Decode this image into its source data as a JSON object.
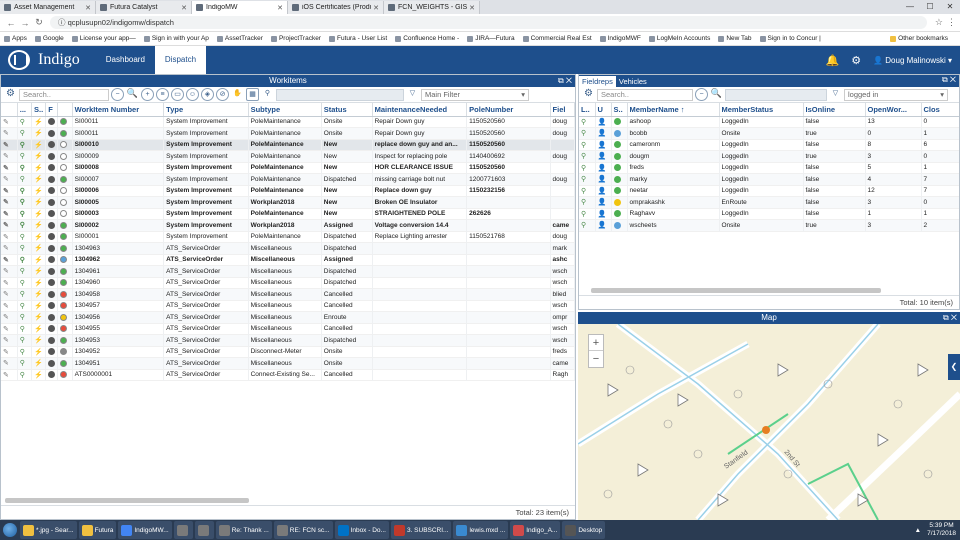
{
  "browser": {
    "tabs": [
      {
        "label": "Asset Management",
        "active": false
      },
      {
        "label": "Futura Catalyst",
        "active": false
      },
      {
        "label": "IndigoMW",
        "active": true
      },
      {
        "label": "iOS Certificates (Producti",
        "active": false
      },
      {
        "label": "FCN_WEIGHTS - GIS v2.0",
        "active": false
      }
    ],
    "url": "qcplusupn02/indigomw/dispatch",
    "bookmarks": [
      "Apps",
      "Google",
      "License your app—",
      "Sign in with your Ap",
      "AssetTracker",
      "ProjectTracker",
      "Futura - User List",
      "Confluence Home -",
      "JIRA—Futura",
      "Commercial Real Est",
      "IndigoMWF",
      "LogMeIn Accounts",
      "New Tab",
      "Sign in to Concur |"
    ],
    "other_bookmarks": "Other bookmarks"
  },
  "app": {
    "brand": "Indigo",
    "nav": [
      {
        "label": "Dashboard",
        "active": false
      },
      {
        "label": "Dispatch",
        "active": true
      }
    ],
    "user": "Doug Malinowski"
  },
  "workitems": {
    "title": "Workitems",
    "search_placeholder": "Search..",
    "filter_placeholder": "Main Filter",
    "columns": [
      "",
      "...",
      "S..",
      "F",
      "",
      "WorkItem Number",
      "Type",
      "Subtype",
      "Status",
      "MaintenanceNeeded",
      "PoleNumber",
      "Fiel"
    ],
    "rows": [
      {
        "num": "SI00011",
        "type": "System Improvement",
        "subtype": "PoleMaintenance",
        "status": "Onsite",
        "maint": "Repair Down guy",
        "pole": "1150520560",
        "field": "doug",
        "bold": false,
        "status_color": "#4caf50"
      },
      {
        "num": "SI00011",
        "type": "System Improvement",
        "subtype": "PoleMaintenance",
        "status": "Onsite",
        "maint": "Repair Down guy",
        "pole": "1150520560",
        "field": "doug",
        "bold": false,
        "status_color": "#4caf50"
      },
      {
        "num": "SI00010",
        "type": "System Improvement",
        "subtype": "PoleMaintenance",
        "status": "New",
        "maint": "replace down guy and an...",
        "pole": "1150520560",
        "field": "",
        "bold": true,
        "selected": true,
        "status_color": "#fff"
      },
      {
        "num": "SI00009",
        "type": "System Improvement",
        "subtype": "PoleMaintenance",
        "status": "New",
        "maint": "Inspect for replacing pole",
        "pole": "1140400692",
        "field": "doug",
        "bold": false,
        "status_color": "#fff"
      },
      {
        "num": "SI00008",
        "type": "System Improvement",
        "subtype": "PoleMaintenance",
        "status": "New",
        "maint": "HOR CLEARANCE ISSUE",
        "pole": "1150520560",
        "field": "",
        "bold": true,
        "status_color": "#fff"
      },
      {
        "num": "SI00007",
        "type": "System Improvement",
        "subtype": "PoleMaintenance",
        "status": "Dispatched",
        "maint": "missing carriage bolt nut",
        "pole": "1200771603",
        "field": "doug",
        "bold": false,
        "status_color": "#4caf50"
      },
      {
        "num": "SI00006",
        "type": "System Improvement",
        "subtype": "PoleMaintenance",
        "status": "New",
        "maint": "Replace down guy",
        "pole": "1150232156",
        "field": "",
        "bold": true,
        "status_color": "#fff"
      },
      {
        "num": "SI00005",
        "type": "System Improvement",
        "subtype": "Workplan2018",
        "status": "New",
        "maint": "Broken OE Insulator",
        "pole": "",
        "field": "",
        "bold": true,
        "status_color": "#fff"
      },
      {
        "num": "SI00003",
        "type": "System Improvement",
        "subtype": "PoleMaintenance",
        "status": "New",
        "maint": "STRAIGHTENED POLE",
        "pole": "262626",
        "field": "",
        "bold": true,
        "status_color": "#fff"
      },
      {
        "num": "SI00002",
        "type": "System Improvement",
        "subtype": "Workplan2018",
        "status": "Assigned",
        "maint": "Voltage conversion 14.4",
        "pole": "",
        "field": "came",
        "bold": true,
        "status_color": "#4caf50"
      },
      {
        "num": "SI00001",
        "type": "System Improvement",
        "subtype": "PoleMaintenance",
        "status": "Dispatched",
        "maint": "Replace Lighting arrester",
        "pole": "1150521768",
        "field": "doug",
        "bold": false,
        "status_color": "#4caf50"
      },
      {
        "num": "1304963",
        "type": "ATS_ServiceOrder",
        "subtype": "Miscellaneous",
        "status": "Dispatched",
        "maint": "",
        "pole": "",
        "field": "mark",
        "bold": false,
        "status_color": "#4caf50"
      },
      {
        "num": "1304962",
        "type": "ATS_ServiceOrder",
        "subtype": "Miscellaneous",
        "status": "Assigned",
        "maint": "",
        "pole": "",
        "field": "ashc",
        "bold": true,
        "status_color": "#5aa0d8"
      },
      {
        "num": "1304961",
        "type": "ATS_ServiceOrder",
        "subtype": "Miscellaneous",
        "status": "Dispatched",
        "maint": "",
        "pole": "",
        "field": "wsch",
        "bold": false,
        "status_color": "#4caf50"
      },
      {
        "num": "1304960",
        "type": "ATS_ServiceOrder",
        "subtype": "Miscellaneous",
        "status": "Dispatched",
        "maint": "",
        "pole": "",
        "field": "wsch",
        "bold": false,
        "status_color": "#4caf50"
      },
      {
        "num": "1304958",
        "type": "ATS_ServiceOrder",
        "subtype": "Miscellaneous",
        "status": "Cancelled",
        "maint": "",
        "pole": "",
        "field": "blied",
        "bold": false,
        "status_color": "#e74c3c"
      },
      {
        "num": "1304957",
        "type": "ATS_ServiceOrder",
        "subtype": "Miscellaneous",
        "status": "Cancelled",
        "maint": "",
        "pole": "",
        "field": "wsch",
        "bold": false,
        "status_color": "#e74c3c"
      },
      {
        "num": "1304956",
        "type": "ATS_ServiceOrder",
        "subtype": "Miscellaneous",
        "status": "Enroute",
        "maint": "",
        "pole": "",
        "field": "ompr",
        "bold": false,
        "status_color": "#f1c40f"
      },
      {
        "num": "1304955",
        "type": "ATS_ServiceOrder",
        "subtype": "Miscellaneous",
        "status": "Cancelled",
        "maint": "",
        "pole": "",
        "field": "wsch",
        "bold": false,
        "status_color": "#e74c3c"
      },
      {
        "num": "1304953",
        "type": "ATS_ServiceOrder",
        "subtype": "Miscellaneous",
        "status": "Dispatched",
        "maint": "",
        "pole": "",
        "field": "wsch",
        "bold": false,
        "status_color": "#4caf50"
      },
      {
        "num": "1304952",
        "type": "ATS_ServiceOrder",
        "subtype": "Disconnect-Meter",
        "status": "Onsite",
        "maint": "",
        "pole": "",
        "field": "freds",
        "bold": false,
        "status_color": "#888"
      },
      {
        "num": "1304951",
        "type": "ATS_ServiceOrder",
        "subtype": "Miscellaneous",
        "status": "Onsite",
        "maint": "",
        "pole": "",
        "field": "came",
        "bold": false,
        "status_color": "#4caf50"
      },
      {
        "num": "ATS0000001",
        "type": "ATS_ServiceOrder",
        "subtype": "Connect-Existing Se...",
        "status": "Cancelled",
        "maint": "",
        "pole": "",
        "field": "Ragh",
        "bold": false,
        "status_color": "#e74c3c"
      }
    ],
    "total": "Total: 23 item(s)"
  },
  "fieldreps": {
    "tabs": [
      {
        "label": "Fieldreps",
        "active": true
      },
      {
        "label": "Vehicles",
        "active": false
      }
    ],
    "search_placeholder": "Search..",
    "filter_value": "logged in",
    "columns": [
      "L..",
      "U",
      "S..",
      "MemberName ↑",
      "MemberStatus",
      "IsOnline",
      "OpenWor...",
      "Clos"
    ],
    "rows": [
      {
        "name": "ashoop",
        "status": "LoggedIn",
        "online": "false",
        "open": "13",
        "closed": "0",
        "avatar": "#4caf50"
      },
      {
        "name": "bcobb",
        "status": "Onsite",
        "online": "true",
        "open": "0",
        "closed": "1",
        "avatar": "#5aa0d8"
      },
      {
        "name": "cameronm",
        "status": "LoggedIn",
        "online": "false",
        "open": "8",
        "closed": "6",
        "avatar": "#4caf50"
      },
      {
        "name": "dougm",
        "status": "LoggedIn",
        "online": "true",
        "open": "3",
        "closed": "0",
        "avatar": "#4caf50"
      },
      {
        "name": "freds",
        "status": "LoggedIn",
        "online": "false",
        "open": "5",
        "closed": "1",
        "avatar": "#4caf50"
      },
      {
        "name": "marky",
        "status": "LoggedIn",
        "online": "false",
        "open": "4",
        "closed": "7",
        "avatar": "#4caf50"
      },
      {
        "name": "neetar",
        "status": "LoggedIn",
        "online": "false",
        "open": "12",
        "closed": "7",
        "avatar": "#4caf50"
      },
      {
        "name": "omprakashk",
        "status": "EnRoute",
        "online": "false",
        "open": "3",
        "closed": "0",
        "avatar": "#f1c40f"
      },
      {
        "name": "Raghavv",
        "status": "LoggedIn",
        "online": "false",
        "open": "1",
        "closed": "1",
        "avatar": "#4caf50"
      },
      {
        "name": "wscheets",
        "status": "Onsite",
        "online": "true",
        "open": "3",
        "closed": "2",
        "avatar": "#5aa0d8"
      }
    ],
    "total": "Total: 10 item(s)"
  },
  "map": {
    "title": "Map",
    "zoom_in": "+",
    "zoom_out": "−",
    "street_labels": [
      "Stanfield",
      "2nd St"
    ]
  },
  "taskbar": {
    "items": [
      "*.jpg - Sear...",
      "Futura",
      "IndigoMW...",
      "",
      "",
      "Re: Thank ...",
      "RE: FCN sc...",
      "Inbox - Do...",
      "3. SUBSCRI...",
      "lewis.mxd ...",
      "Indigo_A...",
      "Desktop"
    ],
    "time": "5:39 PM",
    "date": "7/17/2018"
  }
}
